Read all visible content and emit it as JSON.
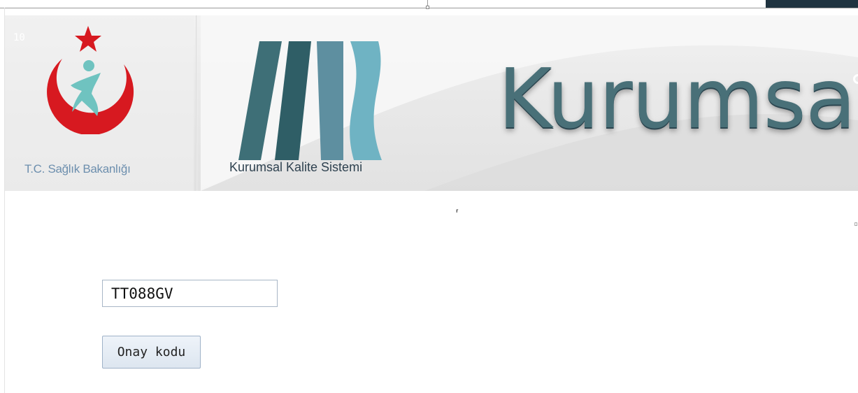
{
  "header": {
    "ministry_name": "T.C. Sağlık Bakanlığı",
    "system_logo_text": "Kurumsal Kalite Sistemi",
    "banner_title": "Kurumsa",
    "faint_corner_text": "10"
  },
  "form": {
    "code_value": "TT088GV",
    "confirm_button_label": "Onay kodu"
  },
  "misc": {
    "cursor_glyph": "⸢"
  },
  "colors": {
    "ministry_red": "#d71920",
    "ministry_teal": "#6fc3c0",
    "logo_dark": "#2f5e66",
    "logo_light": "#6fb3c3",
    "title_color": "#497078",
    "button_bg": "#dde6f0"
  }
}
